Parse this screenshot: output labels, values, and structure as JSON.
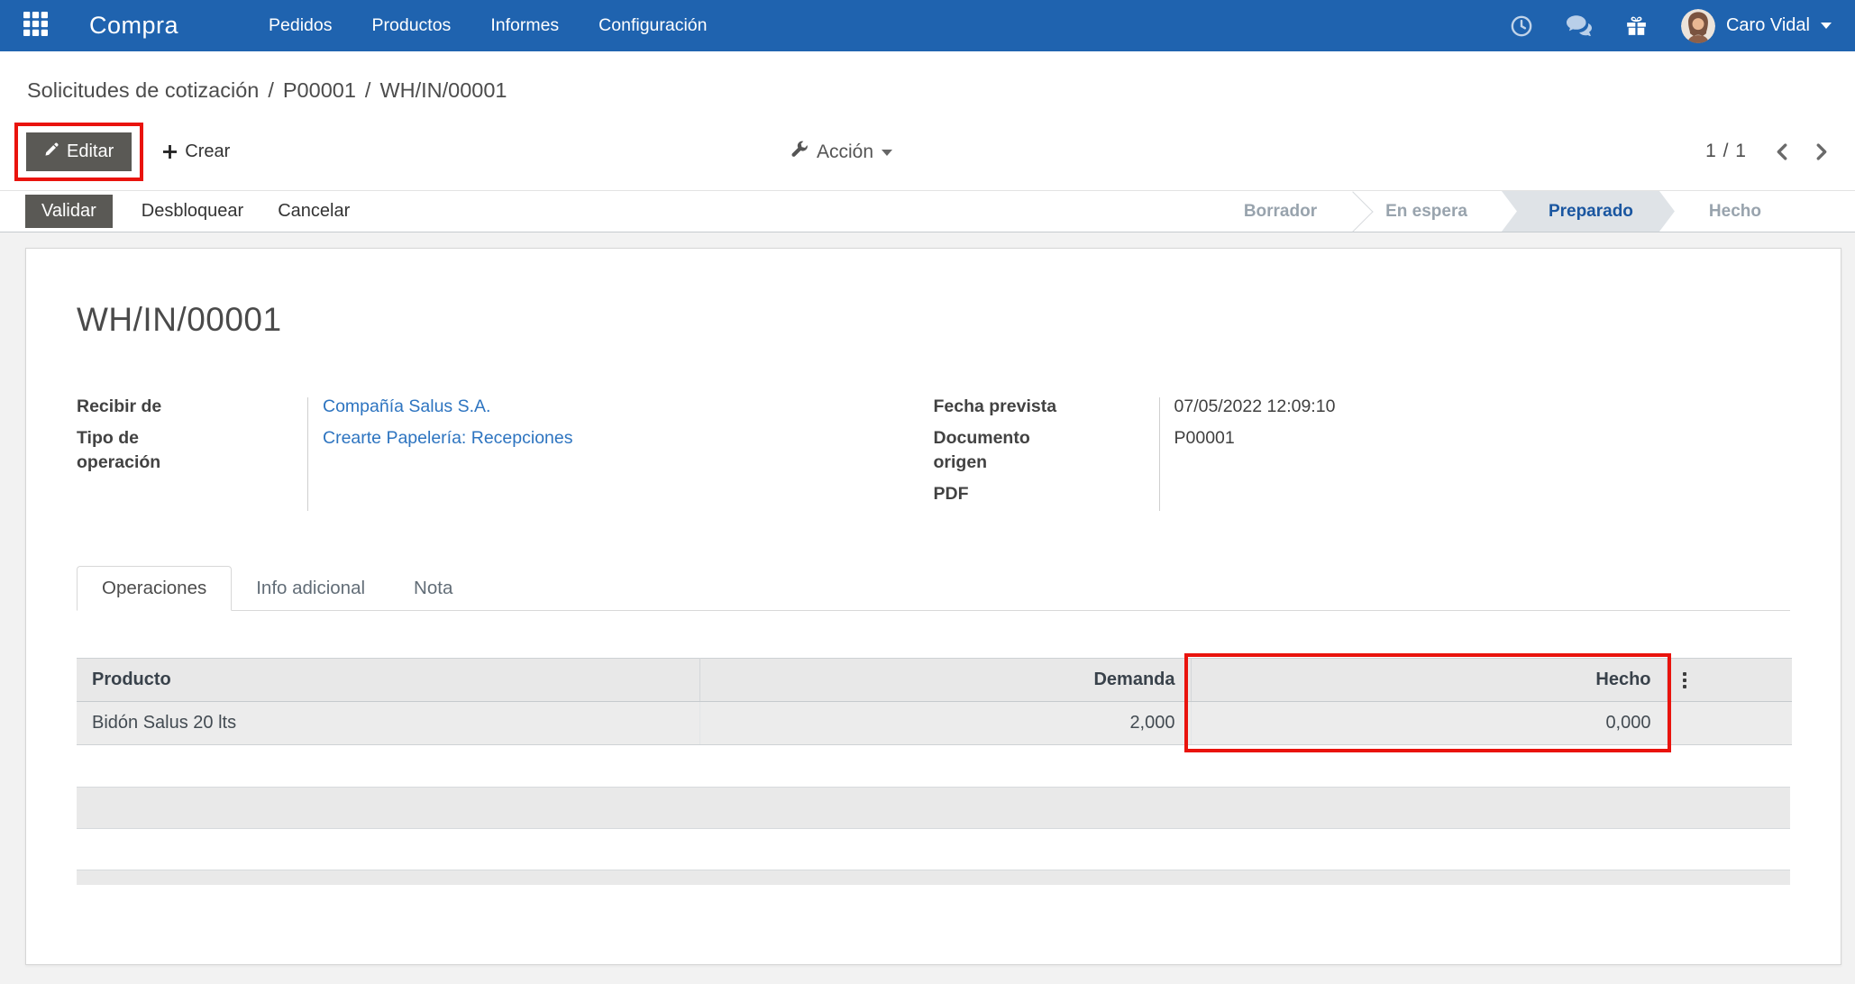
{
  "colors": {
    "navbar_bg": "#1f63af",
    "link": "#2d74c0",
    "annotation": "#e9130d",
    "btn_dark": "#5a5955",
    "stage_active_bg": "#dfe3e7",
    "stage_active_text": "#1a56a0"
  },
  "navbar": {
    "app_name": "Compra",
    "menus": [
      "Pedidos",
      "Productos",
      "Informes",
      "Configuración"
    ],
    "user_name": "Caro Vidal"
  },
  "breadcrumb": {
    "separator": "/",
    "items": [
      "Solicitudes de cotización",
      "P00001",
      "WH/IN/00001"
    ]
  },
  "control_panel": {
    "edit_label": "Editar",
    "create_label": "Crear",
    "action_label": "Acción",
    "pager": "1 / 1"
  },
  "statusbar": {
    "buttons": [
      "Validar",
      "Desbloquear",
      "Cancelar"
    ],
    "stages": [
      {
        "label": "Borrador",
        "active": false
      },
      {
        "label": "En espera",
        "active": false
      },
      {
        "label": "Preparado",
        "active": true
      },
      {
        "label": "Hecho",
        "active": false
      }
    ]
  },
  "form": {
    "title": "WH/IN/00001",
    "fields_left": [
      {
        "label": "Recibir de",
        "value": "Compañía Salus S.A.",
        "link": true
      },
      {
        "label": "Tipo de operación",
        "value": "Crearte Papelería: Recepciones",
        "link": true
      }
    ],
    "fields_right": [
      {
        "label": "Fecha prevista",
        "value": "07/05/2022 12:09:10",
        "link": false
      },
      {
        "label": "Documento origen",
        "value": "P00001",
        "link": false
      },
      {
        "label": "PDF",
        "value": "",
        "link": false
      }
    ],
    "tabs": [
      {
        "label": "Operaciones",
        "active": true
      },
      {
        "label": "Info adicional",
        "active": false
      },
      {
        "label": "Nota",
        "active": false
      }
    ],
    "table": {
      "headers": [
        "Producto",
        "Demanda",
        "Hecho"
      ],
      "rows": [
        [
          "Bidón Salus 20 lts",
          "2,000",
          "0,000"
        ]
      ]
    }
  }
}
